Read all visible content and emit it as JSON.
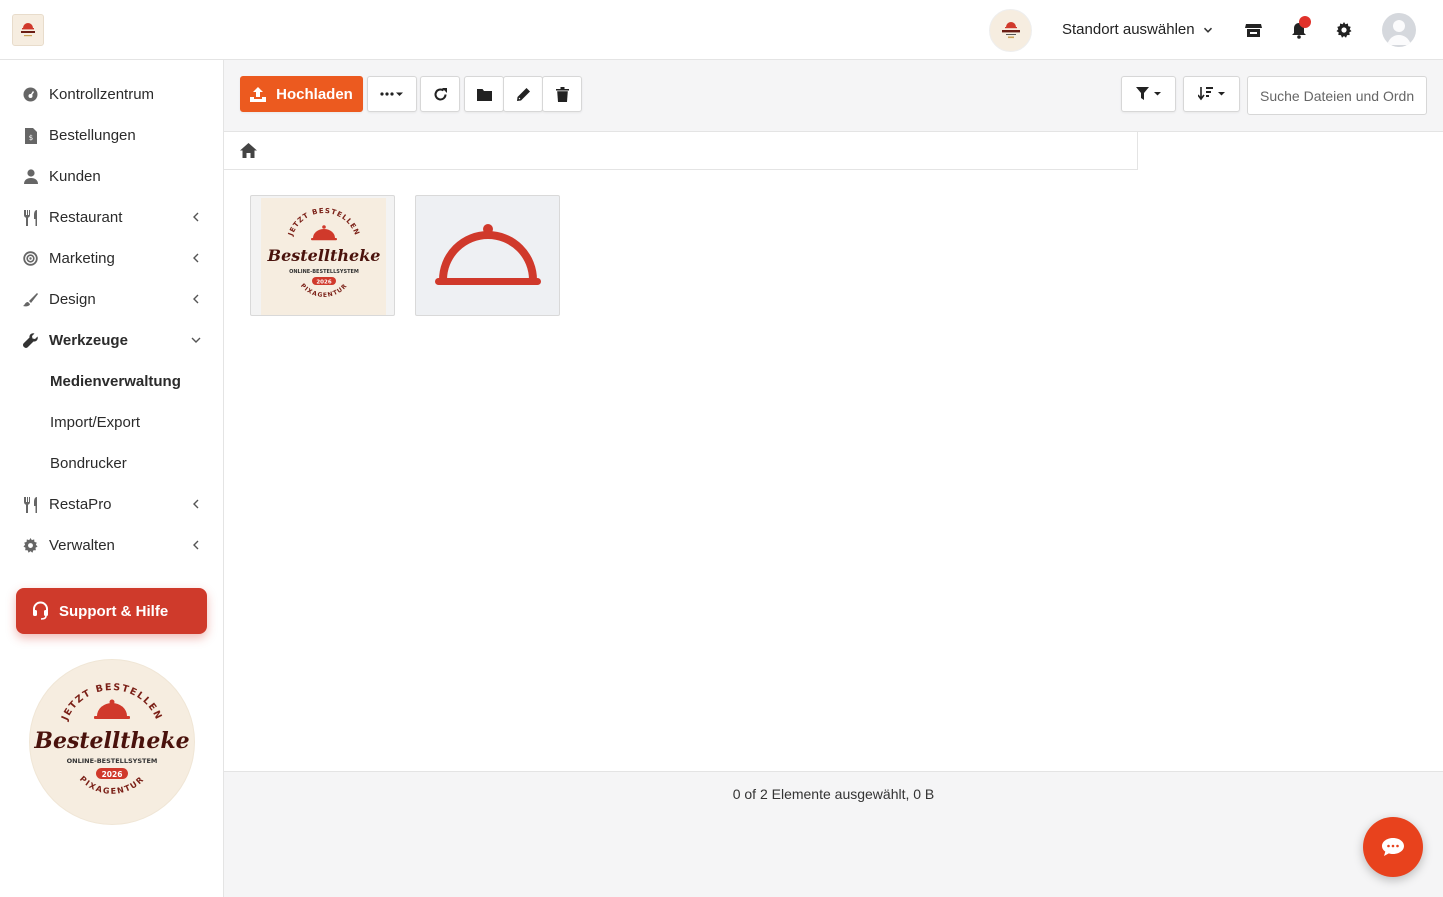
{
  "header": {
    "location_label": "Standort auswählen",
    "brand": {
      "arc_top": "JETZT BESTELLEN",
      "name": "Bestelltheke",
      "tagline": "ONLINE-BESTELLSYSTEM",
      "year": "2026",
      "arc_bottom": "PIXAGENTUR"
    }
  },
  "sidebar": {
    "items": [
      {
        "label": "Kontrollzentrum",
        "icon": "dashboard-icon"
      },
      {
        "label": "Bestellungen",
        "icon": "receipt-icon"
      },
      {
        "label": "Kunden",
        "icon": "user-icon"
      },
      {
        "label": "Restaurant",
        "icon": "utensils-icon"
      },
      {
        "label": "Marketing",
        "icon": "target-icon"
      },
      {
        "label": "Design",
        "icon": "brush-icon"
      },
      {
        "label": "Werkzeuge",
        "icon": "wrench-icon"
      },
      {
        "label": "RestaPro",
        "icon": "utensils-icon"
      },
      {
        "label": "Verwalten",
        "icon": "gear-icon"
      }
    ],
    "sub_items": [
      "Medienverwaltung",
      "Import/Export",
      "Bondrucker"
    ],
    "support_label": "Support & Hilfe"
  },
  "toolbar": {
    "upload_label": "Hochladen",
    "search_placeholder": "Suche Dateien und Ordner"
  },
  "files": [
    {
      "type": "logo-image"
    },
    {
      "type": "cloche-image"
    }
  ],
  "status_text": "0 of 2 Elemente ausgewählt, 0 B",
  "colors": {
    "accent": "#ec5a1f",
    "support": "#cf3a2b",
    "cloche": "#d0392b"
  }
}
